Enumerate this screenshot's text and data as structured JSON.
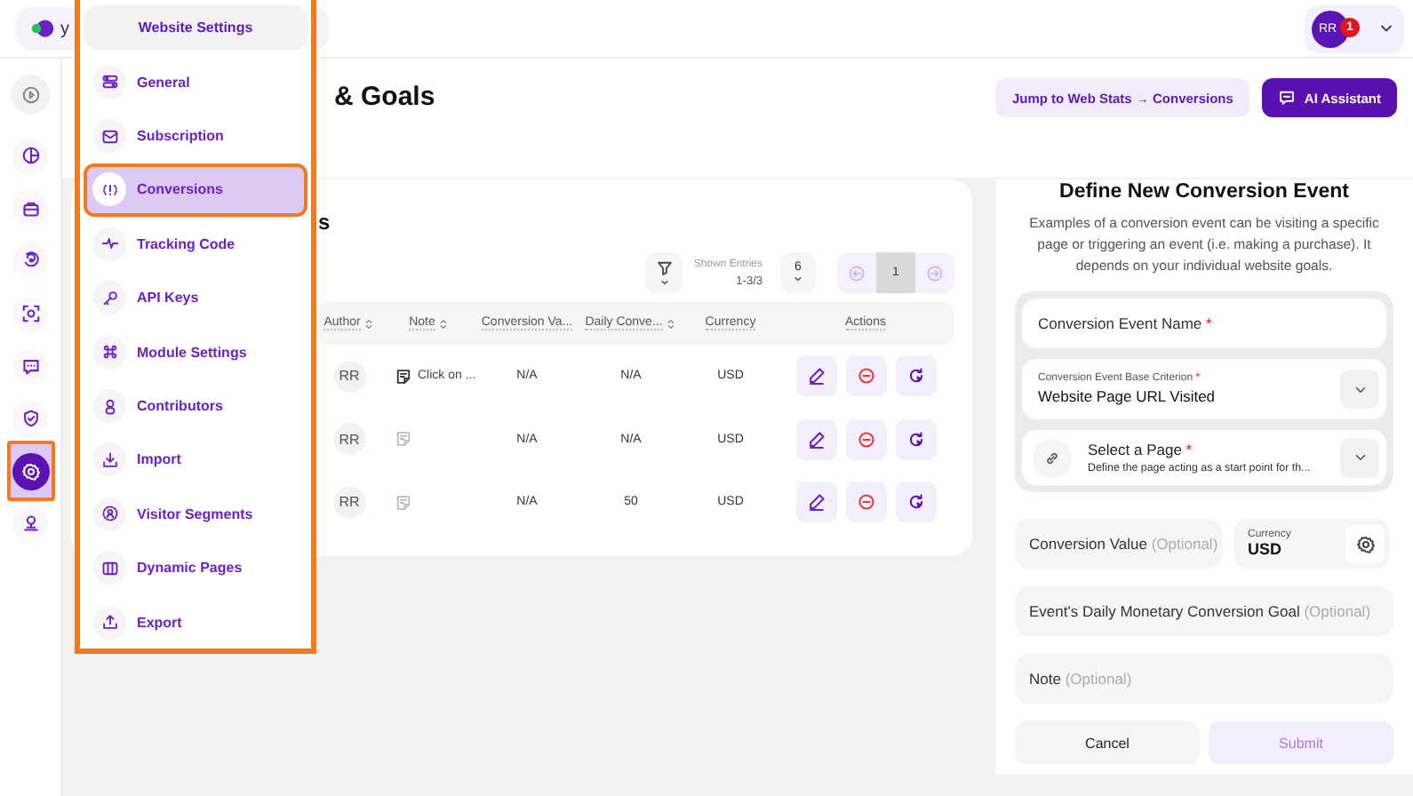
{
  "top_bar": {
    "site_name": "y",
    "user": {
      "initials": "RR",
      "notifications": "1"
    }
  },
  "rail": {
    "items": [
      {
        "kind": "collapse",
        "selected": false
      },
      {
        "kind": "analytics",
        "selected": false
      },
      {
        "kind": "bag",
        "selected": false
      },
      {
        "kind": "spiral",
        "selected": false
      },
      {
        "kind": "scan",
        "selected": false
      },
      {
        "kind": "chat",
        "selected": false
      },
      {
        "kind": "shield",
        "selected": false
      },
      {
        "kind": "settings",
        "selected": true
      },
      {
        "kind": "user_pin",
        "selected": false
      }
    ]
  },
  "settings_menu": {
    "title": "Website Settings",
    "items": [
      {
        "kind": "general",
        "label": "General",
        "selected": false
      },
      {
        "kind": "subscription",
        "label": "Subscription",
        "selected": false
      },
      {
        "kind": "conversions",
        "label": "Conversions",
        "selected": true
      },
      {
        "kind": "tracking",
        "label": "Tracking Code",
        "selected": false
      },
      {
        "kind": "api_keys",
        "label": "API Keys",
        "selected": false
      },
      {
        "kind": "module",
        "label": "Module Settings",
        "selected": false
      },
      {
        "kind": "contributors",
        "label": "Contributors",
        "selected": false
      },
      {
        "kind": "import",
        "label": "Import",
        "selected": false
      },
      {
        "kind": "visitor_segments",
        "label": "Visitor Segments",
        "selected": false
      },
      {
        "kind": "dynamic_pages",
        "label": "Dynamic Pages",
        "selected": false
      },
      {
        "kind": "export",
        "label": "Export",
        "selected": false
      }
    ]
  },
  "page": {
    "title": "& Goals",
    "actions": [
      {
        "kind": "secondary",
        "label": "Jump to Web Stats → Conversions"
      },
      {
        "kind": "primary",
        "label": "AI Assistant"
      }
    ]
  },
  "table": {
    "title": "s",
    "toolbar": {
      "entries_label": "Shown Entries",
      "entries": "1-3/3",
      "page_size": "6",
      "pages": [
        {
          "label": "1",
          "selected": true
        }
      ]
    },
    "columns": [
      {
        "label": "Author",
        "sortable": true
      },
      {
        "label": "Note",
        "sortable": true
      },
      {
        "label": "Conversion Va...",
        "sortable": false
      },
      {
        "label": "Daily Conve...",
        "sortable": true
      },
      {
        "label": "Currency",
        "sortable": false
      },
      {
        "label": "Actions",
        "sortable": false
      }
    ],
    "rows": [
      {
        "author": "RR",
        "has_note": true,
        "note": "Click on ...",
        "conversion_value": "N/A",
        "daily_goal": "N/A",
        "currency": "USD"
      },
      {
        "author": "RR",
        "has_note": false,
        "conversion_value": "N/A",
        "daily_goal": "N/A",
        "currency": "USD"
      },
      {
        "author": "RR",
        "has_note": false,
        "conversion_value": "N/A",
        "daily_goal": "50",
        "currency": "USD"
      }
    ]
  },
  "form": {
    "title": "Define New Conversion Event",
    "description": "Examples of a conversion event can be visiting a specific page or triggering an event (i.e. making a purchase). It depends on your individual website goals.",
    "event_fields": [
      {
        "kind": "text",
        "label": "Conversion Event Name",
        "required_mark": "*"
      },
      {
        "kind": "select",
        "label": "Conversion Event Base Criterion",
        "required_mark": "*",
        "value": "Website Page URL Visited"
      },
      {
        "kind": "page_select",
        "label": "Select a Page",
        "required_mark": "*",
        "description": "Define the page acting as a start point for th..."
      }
    ],
    "value_field": {
      "label": "Conversion Value",
      "hint": "(Optional)"
    },
    "currency": {
      "label": "Currency",
      "value": "USD"
    },
    "goal_field": {
      "label": "Event's Daily Monetary Conversion Goal",
      "hint": "(Optional)"
    },
    "note_field": {
      "label": "Note",
      "hint": "(Optional)"
    },
    "buttons": [
      {
        "label": "Cancel",
        "disabled": false
      },
      {
        "label": "Submit",
        "disabled": true
      }
    ]
  }
}
